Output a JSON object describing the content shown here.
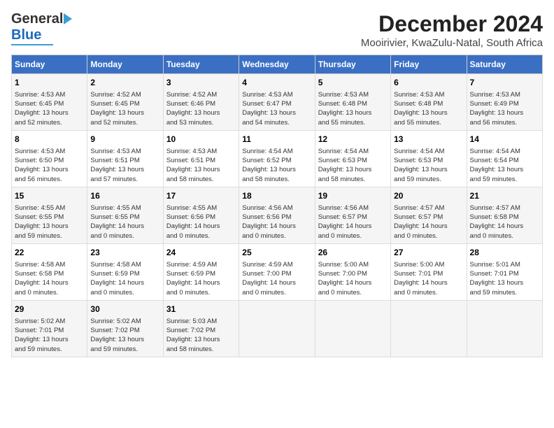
{
  "header": {
    "logo_general": "General",
    "logo_blue": "Blue",
    "main_title": "December 2024",
    "subtitle": "Mooirivier, KwaZulu-Natal, South Africa"
  },
  "calendar": {
    "days_of_week": [
      "Sunday",
      "Monday",
      "Tuesday",
      "Wednesday",
      "Thursday",
      "Friday",
      "Saturday"
    ],
    "weeks": [
      [
        {
          "day": "1",
          "info": "Sunrise: 4:53 AM\nSunset: 6:45 PM\nDaylight: 13 hours\nand 52 minutes."
        },
        {
          "day": "2",
          "info": "Sunrise: 4:52 AM\nSunset: 6:45 PM\nDaylight: 13 hours\nand 52 minutes."
        },
        {
          "day": "3",
          "info": "Sunrise: 4:52 AM\nSunset: 6:46 PM\nDaylight: 13 hours\nand 53 minutes."
        },
        {
          "day": "4",
          "info": "Sunrise: 4:53 AM\nSunset: 6:47 PM\nDaylight: 13 hours\nand 54 minutes."
        },
        {
          "day": "5",
          "info": "Sunrise: 4:53 AM\nSunset: 6:48 PM\nDaylight: 13 hours\nand 55 minutes."
        },
        {
          "day": "6",
          "info": "Sunrise: 4:53 AM\nSunset: 6:48 PM\nDaylight: 13 hours\nand 55 minutes."
        },
        {
          "day": "7",
          "info": "Sunrise: 4:53 AM\nSunset: 6:49 PM\nDaylight: 13 hours\nand 56 minutes."
        }
      ],
      [
        {
          "day": "8",
          "info": "Sunrise: 4:53 AM\nSunset: 6:50 PM\nDaylight: 13 hours\nand 56 minutes."
        },
        {
          "day": "9",
          "info": "Sunrise: 4:53 AM\nSunset: 6:51 PM\nDaylight: 13 hours\nand 57 minutes."
        },
        {
          "day": "10",
          "info": "Sunrise: 4:53 AM\nSunset: 6:51 PM\nDaylight: 13 hours\nand 58 minutes."
        },
        {
          "day": "11",
          "info": "Sunrise: 4:54 AM\nSunset: 6:52 PM\nDaylight: 13 hours\nand 58 minutes."
        },
        {
          "day": "12",
          "info": "Sunrise: 4:54 AM\nSunset: 6:53 PM\nDaylight: 13 hours\nand 58 minutes."
        },
        {
          "day": "13",
          "info": "Sunrise: 4:54 AM\nSunset: 6:53 PM\nDaylight: 13 hours\nand 59 minutes."
        },
        {
          "day": "14",
          "info": "Sunrise: 4:54 AM\nSunset: 6:54 PM\nDaylight: 13 hours\nand 59 minutes."
        }
      ],
      [
        {
          "day": "15",
          "info": "Sunrise: 4:55 AM\nSunset: 6:55 PM\nDaylight: 13 hours\nand 59 minutes."
        },
        {
          "day": "16",
          "info": "Sunrise: 4:55 AM\nSunset: 6:55 PM\nDaylight: 14 hours\nand 0 minutes."
        },
        {
          "day": "17",
          "info": "Sunrise: 4:55 AM\nSunset: 6:56 PM\nDaylight: 14 hours\nand 0 minutes."
        },
        {
          "day": "18",
          "info": "Sunrise: 4:56 AM\nSunset: 6:56 PM\nDaylight: 14 hours\nand 0 minutes."
        },
        {
          "day": "19",
          "info": "Sunrise: 4:56 AM\nSunset: 6:57 PM\nDaylight: 14 hours\nand 0 minutes."
        },
        {
          "day": "20",
          "info": "Sunrise: 4:57 AM\nSunset: 6:57 PM\nDaylight: 14 hours\nand 0 minutes."
        },
        {
          "day": "21",
          "info": "Sunrise: 4:57 AM\nSunset: 6:58 PM\nDaylight: 14 hours\nand 0 minutes."
        }
      ],
      [
        {
          "day": "22",
          "info": "Sunrise: 4:58 AM\nSunset: 6:58 PM\nDaylight: 14 hours\nand 0 minutes."
        },
        {
          "day": "23",
          "info": "Sunrise: 4:58 AM\nSunset: 6:59 PM\nDaylight: 14 hours\nand 0 minutes."
        },
        {
          "day": "24",
          "info": "Sunrise: 4:59 AM\nSunset: 6:59 PM\nDaylight: 14 hours\nand 0 minutes."
        },
        {
          "day": "25",
          "info": "Sunrise: 4:59 AM\nSunset: 7:00 PM\nDaylight: 14 hours\nand 0 minutes."
        },
        {
          "day": "26",
          "info": "Sunrise: 5:00 AM\nSunset: 7:00 PM\nDaylight: 14 hours\nand 0 minutes."
        },
        {
          "day": "27",
          "info": "Sunrise: 5:00 AM\nSunset: 7:01 PM\nDaylight: 14 hours\nand 0 minutes."
        },
        {
          "day": "28",
          "info": "Sunrise: 5:01 AM\nSunset: 7:01 PM\nDaylight: 13 hours\nand 59 minutes."
        }
      ],
      [
        {
          "day": "29",
          "info": "Sunrise: 5:02 AM\nSunset: 7:01 PM\nDaylight: 13 hours\nand 59 minutes."
        },
        {
          "day": "30",
          "info": "Sunrise: 5:02 AM\nSunset: 7:02 PM\nDaylight: 13 hours\nand 59 minutes."
        },
        {
          "day": "31",
          "info": "Sunrise: 5:03 AM\nSunset: 7:02 PM\nDaylight: 13 hours\nand 58 minutes."
        },
        {
          "day": "",
          "info": ""
        },
        {
          "day": "",
          "info": ""
        },
        {
          "day": "",
          "info": ""
        },
        {
          "day": "",
          "info": ""
        }
      ]
    ]
  }
}
